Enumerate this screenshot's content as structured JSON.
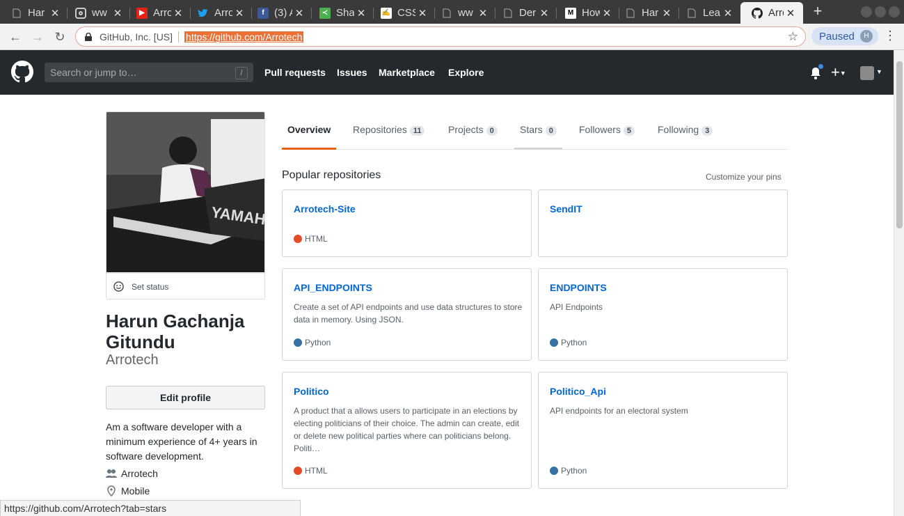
{
  "browser": {
    "tabs": [
      {
        "title": "Har",
        "icon": "doc-icon"
      },
      {
        "title": "ww",
        "icon": "instagram-icon"
      },
      {
        "title": "Arro",
        "icon": "youtube-icon"
      },
      {
        "title": "Arro",
        "icon": "twitter-icon"
      },
      {
        "title": "(3) A",
        "icon": "facebook-icon"
      },
      {
        "title": "Sha",
        "icon": "share-icon"
      },
      {
        "title": "CSS",
        "icon": "signature-icon"
      },
      {
        "title": "ww",
        "icon": "doc-icon"
      },
      {
        "title": "Der",
        "icon": "doc-icon"
      },
      {
        "title": "How",
        "icon": "medium-icon"
      },
      {
        "title": "Har",
        "icon": "doc-icon"
      },
      {
        "title": "Lea",
        "icon": "doc-icon"
      },
      {
        "title": "Arro",
        "icon": "github-icon"
      }
    ],
    "close_glyph": "✕",
    "new_tab": "+",
    "cert": "GitHub, Inc. [US]",
    "url": "https://github.com/Arrotech",
    "paused": "Paused",
    "profile_initial": "H",
    "status_url": "https://github.com/Arrotech?tab=stars"
  },
  "gh": {
    "search_placeholder": "Search or jump to…",
    "search_key": "/",
    "nav": [
      "Pull requests",
      "Issues",
      "Marketplace",
      "Explore"
    ]
  },
  "profile": {
    "set_status": "Set status",
    "full_name": "Harun Gachanja Gitundu",
    "login": "Arrotech",
    "edit_profile": "Edit profile",
    "bio": "Am a software developer with a minimum experience of 4+ years in software development.",
    "org": "Arrotech",
    "location": "Mobile"
  },
  "tabs": [
    {
      "label": "Overview",
      "count": null
    },
    {
      "label": "Repositories",
      "count": "11"
    },
    {
      "label": "Projects",
      "count": "0"
    },
    {
      "label": "Stars",
      "count": "0"
    },
    {
      "label": "Followers",
      "count": "5"
    },
    {
      "label": "Following",
      "count": "3"
    }
  ],
  "repos_section": {
    "title": "Popular repositories",
    "customize": "Customize your pins"
  },
  "repos": [
    {
      "name": "Arrotech-Site",
      "desc": "",
      "lang": "HTML",
      "lang_color": "#e34c26"
    },
    {
      "name": "SendIT",
      "desc": "",
      "lang": "",
      "lang_color": ""
    },
    {
      "name": "API_ENDPOINTS",
      "desc": "Create a set of API endpoints and use data structures to store data in memory. Using JSON.",
      "lang": "Python",
      "lang_color": "#3572A5"
    },
    {
      "name": "ENDPOINTS",
      "desc": "API Endpoints",
      "lang": "Python",
      "lang_color": "#3572A5"
    },
    {
      "name": "Politico",
      "desc": "A product that a allows users to participate in an elections by electing politicians of their choice. The admin can create, edit or delete new political parties where can politicians belong. Politi…",
      "lang": "HTML",
      "lang_color": "#e34c26"
    },
    {
      "name": "Politico_Api",
      "desc": "API endpoints for an electoral system",
      "lang": "Python",
      "lang_color": "#3572A5"
    }
  ],
  "colors": {
    "tab_underline": "#e36209",
    "stars_underline": "#d1d5da",
    "link": "#0366d6"
  }
}
